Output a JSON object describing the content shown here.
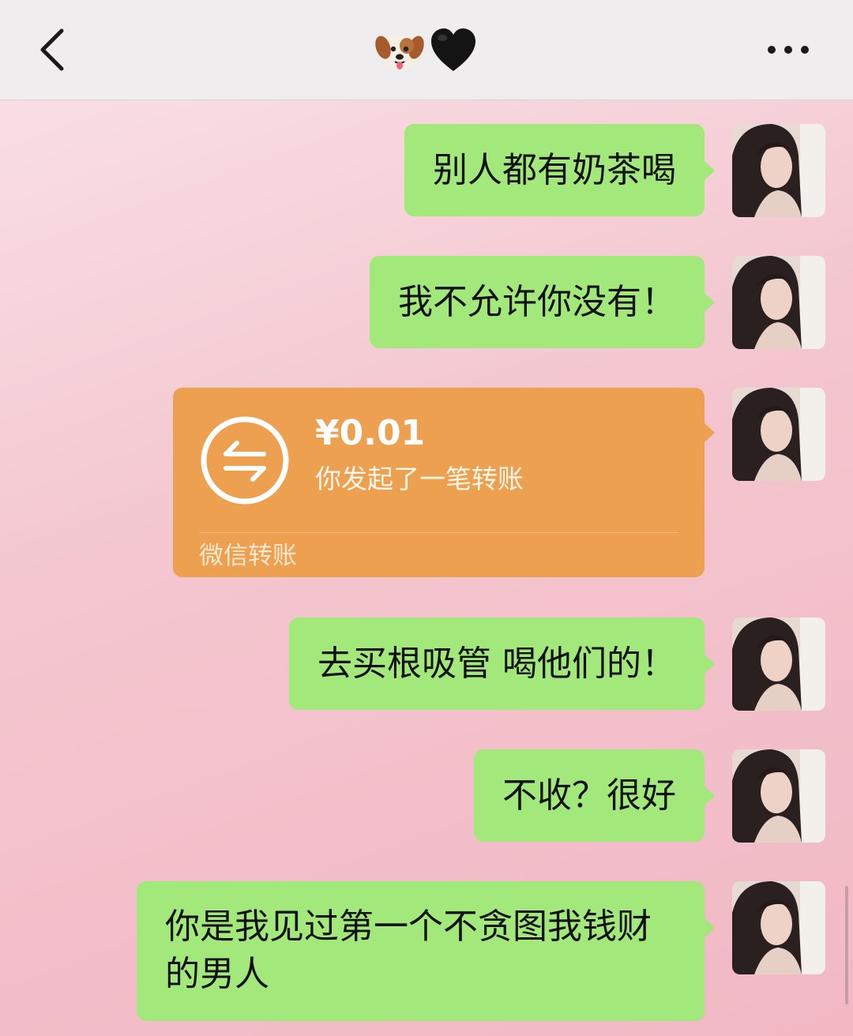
{
  "header": {
    "title_emojis": [
      "dog-face",
      "black-heart"
    ],
    "back_icon": "chevron-left-icon",
    "more_icon": "ellipsis-icon"
  },
  "messages": [
    {
      "type": "text",
      "text": "别人都有奶茶喝"
    },
    {
      "type": "text",
      "text": "我不允许你没有！"
    },
    {
      "type": "transfer",
      "amount": "¥0.01",
      "description": "你发起了一笔转账",
      "footer": "微信转账"
    },
    {
      "type": "text",
      "text": "去买根吸管 喝他们的！"
    },
    {
      "type": "text",
      "text": "不收？很好"
    },
    {
      "type": "text",
      "text": "你是我见过第一个不贪图我钱财的男人"
    }
  ],
  "colors": {
    "header_bg": "#efeded",
    "bubble_green": "#a2e87a",
    "transfer_orange": "#eda04f",
    "chat_bg": "#f4c6cf"
  }
}
